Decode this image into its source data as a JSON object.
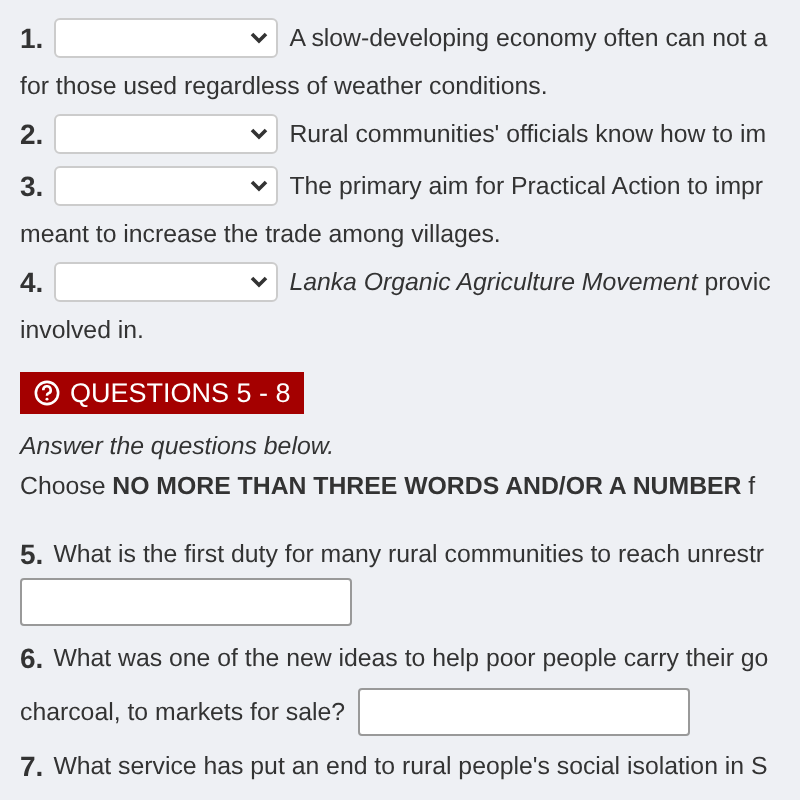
{
  "matching_questions": [
    {
      "number": "1.",
      "lines": [
        "A slow-developing economy often can not a",
        "for those used regardless of weather conditions."
      ]
    },
    {
      "number": "2.",
      "lines": [
        "Rural communities' officials know how to im"
      ]
    },
    {
      "number": "3.",
      "lines": [
        "The primary aim for Practical Action to impr",
        "meant to increase the trade among villages."
      ]
    },
    {
      "number": "4.",
      "lines": [
        "*Lanka Organic Agriculture Movement* provic",
        "involved in."
      ]
    }
  ],
  "section": {
    "title": "QUESTIONS 5 - 8",
    "instruction": "Answer the questions below.",
    "rule": "Choose **NO MORE THAN THREE WORDS AND/OR A NUMBER** f"
  },
  "short_questions": [
    {
      "number": "5.",
      "lines": [
        "What is the first duty for many rural communities to reach unrestr"
      ],
      "kind": "field_below"
    },
    {
      "number": "6.",
      "lines": [
        "What was one of the new ideas to help poor people carry their go",
        "charcoal, to markets for sale?"
      ],
      "kind": "field_inline"
    },
    {
      "number": "7.",
      "lines": [
        "What service has put an end to rural people's social isolation in S"
      ],
      "kind": "plain"
    }
  ]
}
